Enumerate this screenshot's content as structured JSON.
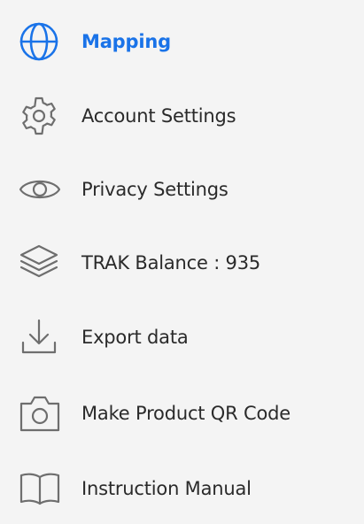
{
  "menu": {
    "items": [
      {
        "label": "Mapping",
        "icon": "globe-icon",
        "active": true
      },
      {
        "label": "Account Settings",
        "icon": "gear-icon",
        "active": false
      },
      {
        "label": "Privacy Settings",
        "icon": "eye-icon",
        "active": false
      },
      {
        "label": "TRAK Balance : 935",
        "icon": "layers-icon",
        "active": false
      },
      {
        "label": "Export data",
        "icon": "download-icon",
        "active": false
      },
      {
        "label": "Make Product QR Code",
        "icon": "camera-icon",
        "active": false
      },
      {
        "label": "Instruction Manual",
        "icon": "book-icon",
        "active": false
      }
    ]
  },
  "colors": {
    "active": "#1a73e8",
    "icon": "#6e6e6e",
    "text": "#2a2a2a",
    "background": "#f4f4f4"
  }
}
